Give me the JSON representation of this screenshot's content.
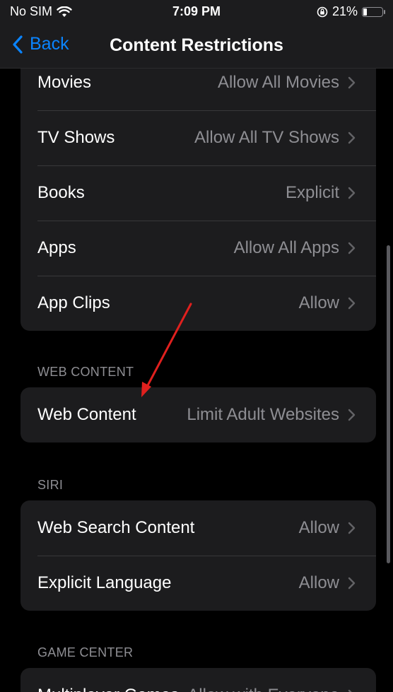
{
  "status": {
    "carrier": "No SIM",
    "time": "7:09 PM",
    "battery": "21%",
    "icons": [
      "wifi-icon",
      "orientation-lock-icon",
      "battery-icon"
    ],
    "battery_level": 0.21
  },
  "nav": {
    "back_label": "Back",
    "title": "Content Restrictions"
  },
  "colors": {
    "accent": "#0a84ff",
    "annotation": "#e0201e",
    "background": "#000000",
    "cell": "#1c1c1e"
  },
  "groups": {
    "media": {
      "rows": [
        {
          "label": "Movies",
          "value": "Allow All Movies"
        },
        {
          "label": "TV Shows",
          "value": "Allow All TV Shows"
        },
        {
          "label": "Books",
          "value": "Explicit"
        },
        {
          "label": "Apps",
          "value": "Allow All Apps"
        },
        {
          "label": "App Clips",
          "value": "Allow"
        }
      ]
    },
    "web": {
      "header": "WEB CONTENT",
      "rows": [
        {
          "label": "Web Content",
          "value": "Limit Adult Websites"
        }
      ]
    },
    "siri": {
      "header": "SIRI",
      "rows": [
        {
          "label": "Web Search Content",
          "value": "Allow"
        },
        {
          "label": "Explicit Language",
          "value": "Allow"
        }
      ]
    },
    "game_center": {
      "header": "GAME CENTER",
      "rows": [
        {
          "label": "Multiplayer Games",
          "value": "Allow with Everyone"
        }
      ]
    }
  }
}
